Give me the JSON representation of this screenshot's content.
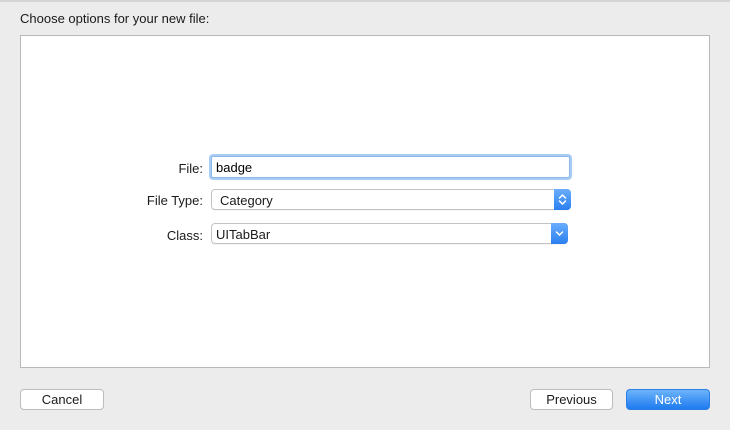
{
  "dialog": {
    "heading": "Choose options for your new file:"
  },
  "form": {
    "file_label": "File:",
    "file_value": "badge",
    "file_type_label": "File Type:",
    "file_type_value": "Category",
    "class_label": "Class:",
    "class_value": "UITabBar"
  },
  "buttons": {
    "cancel": "Cancel",
    "previous": "Previous",
    "next": "Next"
  },
  "colors": {
    "accent": "#2a7ff0",
    "focus_ring": "#a8cdf5",
    "window_bg": "#ececec"
  },
  "icons": {
    "file_type_popup": "up-down-chevrons-icon",
    "class_popup": "chevron-down-icon"
  }
}
